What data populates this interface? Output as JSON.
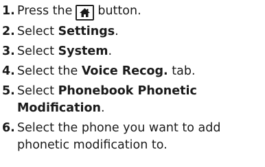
{
  "steps": [
    {
      "num": "1.",
      "pre": "Press the",
      "icon": "home-icon",
      "post": "button."
    },
    {
      "num": "2.",
      "pre": "Select ",
      "bold": "Settings",
      "post": "."
    },
    {
      "num": "3.",
      "pre": "Select ",
      "bold": "System",
      "post": "."
    },
    {
      "num": "4.",
      "pre": "Select the ",
      "bold": "Voice Recog.",
      "post": " tab."
    },
    {
      "num": "5.",
      "pre": "Select ",
      "bold": "Phonebook Phonetic Modification",
      "post": "."
    },
    {
      "num": "6.",
      "text": "Select the phone you want to add phonetic modification to."
    }
  ]
}
